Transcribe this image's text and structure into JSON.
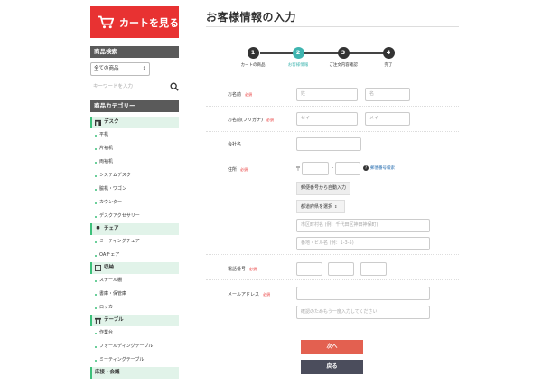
{
  "sidebar": {
    "cart_button": "カートを見る",
    "product_search_heading": "商品検索",
    "category_select_value": "全ての商品",
    "keyword_placeholder": "キーワードを入力",
    "category_heading": "商品カテゴリー",
    "groups": [
      {
        "label": "デスク",
        "items": [
          "平机",
          "片袖机",
          "両袖机",
          "システムデスク",
          "脇机・ワゴン",
          "カウンター",
          "デスクアクセサリー"
        ]
      },
      {
        "label": "チェア",
        "items": [
          "ミーティングチェア",
          "OAチェア"
        ]
      },
      {
        "label": "収納",
        "items": [
          "スチール棚",
          "書庫・保管庫",
          "ロッカー"
        ]
      },
      {
        "label": "テーブル",
        "items": [
          "作業台",
          "フォールディングテーブル",
          "ミーティングテーブル"
        ]
      },
      {
        "label": "応接・会議",
        "items": []
      }
    ]
  },
  "main": {
    "title": "お客様情報の入力",
    "steps": [
      {
        "num": "1",
        "label": "カートの商品",
        "active": false
      },
      {
        "num": "2",
        "label": "お客様情報",
        "active": true
      },
      {
        "num": "3",
        "label": "ご注文内容確認",
        "active": false
      },
      {
        "num": "4",
        "label": "完了",
        "active": false
      }
    ],
    "required_badge": "必須",
    "form": {
      "name_label": "お名前",
      "name_last_placeholder": "姓",
      "name_first_placeholder": "名",
      "kana_label": "お名前(フリガナ)",
      "kana_last_placeholder": "セイ",
      "kana_first_placeholder": "メイ",
      "company_label": "会社名",
      "address_label": "住所",
      "postal_mark": "〒",
      "postal_sep": "-",
      "postal_lookup_link": "郵便番号検索",
      "postal_autofill_button": "郵便番号から自動入力",
      "prefecture_select": "都道府県を選択",
      "city_placeholder": "市区町村名 (例：千代田区神田神保町)",
      "building_placeholder": "番地・ビル名 (例：1-3-5)",
      "phone_label": "電話番号",
      "phone_sep": "-",
      "email_label": "メールアドレス",
      "email_confirm_placeholder": "確認のためもう一度入力してください"
    },
    "next_button": "次へ",
    "back_button": "戻る"
  },
  "colors": {
    "accent_red": "#e83232",
    "step_active": "#3fb5b0",
    "category_green": "#3cc07a",
    "back_button": "#4b4d5c",
    "next_button": "#e36050"
  }
}
